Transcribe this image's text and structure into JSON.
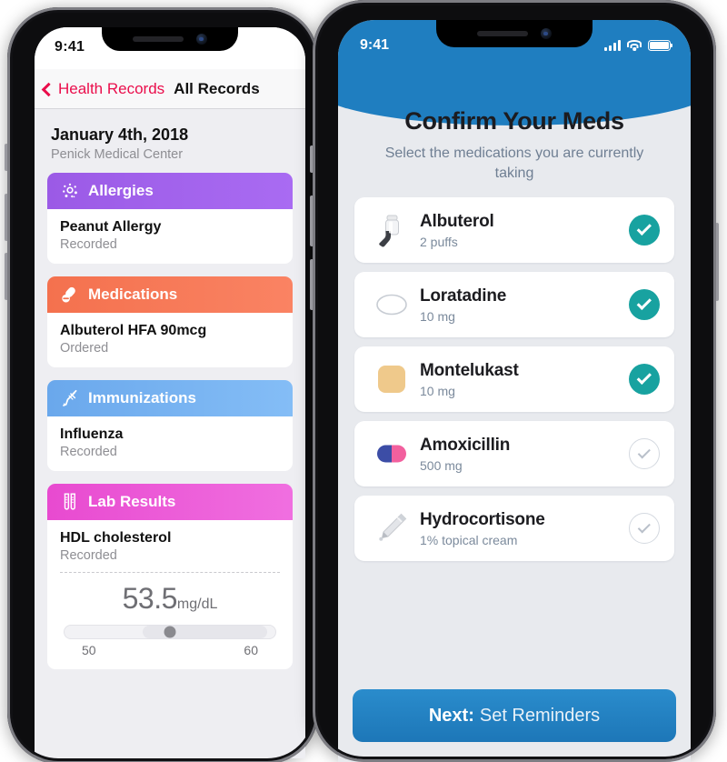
{
  "left_phone": {
    "status_bar": {
      "time": "9:41"
    },
    "nav": {
      "back_icon": "chevron-left-icon",
      "back_label": "Health Records",
      "title": "All Records"
    },
    "record_header": {
      "date": "January 4th, 2018",
      "facility": "Penick Medical Center"
    },
    "groups": [
      {
        "title": "Allergies",
        "icon": "allergen-pollen-icon",
        "color": "#9b5ae6",
        "color_end": "#a96bf2",
        "items": [
          {
            "name": "Peanut Allergy",
            "status": "Recorded"
          }
        ]
      },
      {
        "title": "Medications",
        "icon": "pills-icon",
        "color": "#f4714e",
        "color_end": "#fa8363",
        "items": [
          {
            "name": "Albuterol HFA 90mcg",
            "status": "Ordered"
          }
        ]
      },
      {
        "title": "Immunizations",
        "icon": "syringe-icon",
        "color": "#6aa8ec",
        "color_end": "#84bdf6",
        "items": [
          {
            "name": "Influenza",
            "status": "Recorded"
          }
        ]
      },
      {
        "title": "Lab Results",
        "icon": "test-tubes-icon",
        "color": "#e84ad0",
        "color_end": "#f06fe0",
        "items": [
          {
            "name": "HDL cholesterol",
            "status": "Recorded"
          }
        ],
        "measurement": {
          "value": "53.5",
          "unit": "mg/dL",
          "range_min": "50",
          "range_max": "60"
        }
      }
    ]
  },
  "right_phone": {
    "status_bar": {
      "time": "9:41",
      "signal_icon": "cellular-bars-icon",
      "wifi_icon": "wifi-icon",
      "battery_icon": "battery-full-icon"
    },
    "header": {
      "title": "Confirm Your Meds",
      "subtitle": "Select the medications you are currently taking",
      "accent_color": "#1f7ec0"
    },
    "medications": [
      {
        "name": "Albuterol",
        "dose": "2 puffs",
        "icon": "inhaler-icon",
        "selected": true
      },
      {
        "name": "Loratadine",
        "dose": "10 mg",
        "icon": "oval-pill-icon",
        "selected": true
      },
      {
        "name": "Montelukast",
        "dose": "10 mg",
        "icon": "square-tablet-icon",
        "selected": true
      },
      {
        "name": "Amoxicillin",
        "dose": "500 mg",
        "icon": "capsule-icon",
        "selected": false
      },
      {
        "name": "Hydrocortisone",
        "dose": "1% topical cream",
        "icon": "cream-tube-icon",
        "selected": false
      }
    ],
    "footer": {
      "next_strong": "Next:",
      "next_rest": "Set Reminders"
    },
    "check_on_color": "#18a2a0"
  }
}
